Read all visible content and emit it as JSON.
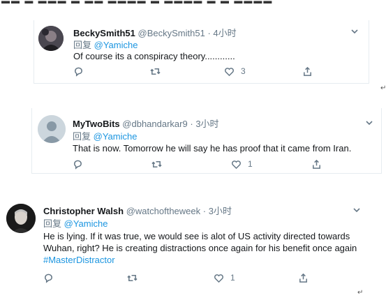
{
  "tweets": [
    {
      "name": "BeckySmith51",
      "handle": "@BeckySmith51",
      "time": "4小时",
      "reply_prefix": "回复",
      "reply_to": "@Yamiche",
      "text": "Of course its a conspiracy theory............",
      "likes": "3"
    },
    {
      "name": "MyTwoBits",
      "handle": "@dbhandarkar9",
      "time": "3小时",
      "reply_prefix": "回复",
      "reply_to": "@Yamiche",
      "text": "That is now. Tomorrow he will say he has proof that it came from Iran.",
      "likes": "1"
    },
    {
      "name": "Christopher Walsh",
      "handle": "@watchoftheweek",
      "time": "3小时",
      "reply_prefix": "回复",
      "reply_to": "@Yamiche",
      "text": "He is lying. If it was true, we would see is alot of US activity directed towards Wuhan, right? He is creating distractions once again for his benefit once again",
      "hashtag": "#MasterDistractor",
      "likes": "1"
    }
  ],
  "colors": {
    "link": "#1b95e0",
    "secondary": "#657786",
    "text": "#14171a",
    "divider": "#e6ecf0"
  },
  "icons": [
    "reply-icon",
    "retweet-icon",
    "like-icon",
    "share-icon",
    "chevron-down-icon"
  ]
}
